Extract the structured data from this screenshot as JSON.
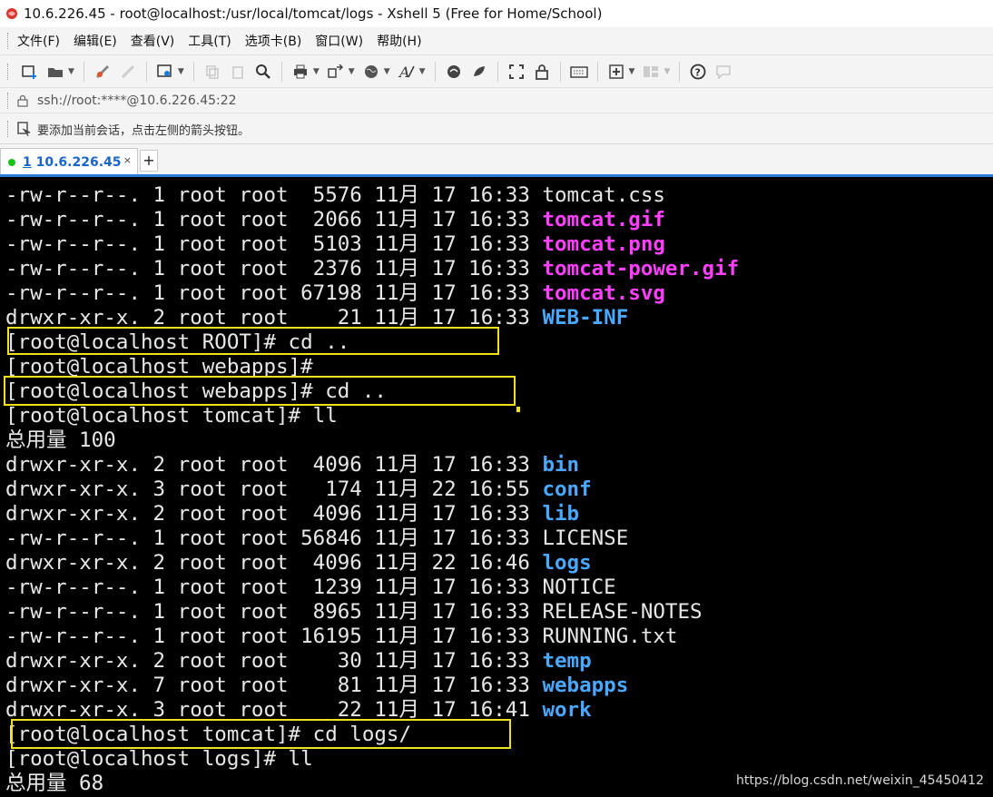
{
  "window": {
    "title": "10.6.226.45  - root@localhost:/usr/local/tomcat/logs - Xshell 5 (Free for Home/School)"
  },
  "menu": [
    {
      "label": "文件(F)"
    },
    {
      "label": "编辑(E)"
    },
    {
      "label": "查看(V)"
    },
    {
      "label": "工具(T)"
    },
    {
      "label": "选项卡(B)"
    },
    {
      "label": "窗口(W)"
    },
    {
      "label": "帮助(H)"
    }
  ],
  "address": {
    "value": "ssh://root:****@10.6.226.45:22"
  },
  "hint": {
    "text": "要添加当前会话，点击左侧的箭头按钮。"
  },
  "tab": {
    "number": "1",
    "label": "10.6.226.45",
    "close": "×",
    "add": "+"
  },
  "terminal": {
    "lines": [
      {
        "prefix": "-rw-r--r--. 1 root root  5576 11月 17 16:33 ",
        "name": "tomcat.css"
      },
      {
        "prefix": "-rw-r--r--. 1 root root  2066 11月 17 16:33 ",
        "name": "tomcat.gif"
      },
      {
        "prefix": "-rw-r--r--. 1 root root  5103 11月 17 16:33 ",
        "name": "tomcat.png"
      },
      {
        "prefix": "-rw-r--r--. 1 root root  2376 11月 17 16:33 ",
        "name": "tomcat-power.gif"
      },
      {
        "prefix": "-rw-r--r--. 1 root root 67198 11月 17 16:33 ",
        "name": "tomcat.svg"
      },
      {
        "prefix": "drwxr-xr-x. 2 root root    21 11月 17 16:33 ",
        "name": "WEB-INF"
      },
      {
        "prefix": "[root@localhost ROOT]# cd ..",
        "name": ""
      },
      {
        "prefix": "[root@localhost webapps]#",
        "name": ""
      },
      {
        "prefix": "[root@localhost webapps]# cd ..",
        "name": ""
      },
      {
        "prefix": "[root@localhost tomcat]# ll",
        "name": ""
      },
      {
        "prefix": "总用量 100",
        "name": ""
      },
      {
        "prefix": "drwxr-xr-x. 2 root root  4096 11月 17 16:33 ",
        "name": "bin"
      },
      {
        "prefix": "drwxr-xr-x. 3 root root   174 11月 22 16:55 ",
        "name": "conf"
      },
      {
        "prefix": "drwxr-xr-x. 2 root root  4096 11月 17 16:33 ",
        "name": "lib"
      },
      {
        "prefix": "-rw-r--r--. 1 root root 56846 11月 17 16:33 ",
        "name": "LICENSE"
      },
      {
        "prefix": "drwxr-xr-x. 2 root root  4096 11月 22 16:46 ",
        "name": "logs"
      },
      {
        "prefix": "-rw-r--r--. 1 root root  1239 11月 17 16:33 ",
        "name": "NOTICE"
      },
      {
        "prefix": "-rw-r--r--. 1 root root  8965 11月 17 16:33 ",
        "name": "RELEASE-NOTES"
      },
      {
        "prefix": "-rw-r--r--. 1 root root 16195 11月 17 16:33 ",
        "name": "RUNNING.txt"
      },
      {
        "prefix": "drwxr-xr-x. 2 root root    30 11月 17 16:33 ",
        "name": "temp"
      },
      {
        "prefix": "drwxr-xr-x. 7 root root    81 11月 17 16:33 ",
        "name": "webapps"
      },
      {
        "prefix": "drwxr-xr-x. 3 root root    22 11月 17 16:41 ",
        "name": "work"
      },
      {
        "prefix": "[root@localhost tomcat]# cd logs/",
        "name": ""
      },
      {
        "prefix": "[root@localhost logs]# ll",
        "name": ""
      },
      {
        "prefix": "总用量 68",
        "name": ""
      }
    ]
  },
  "watermark": {
    "text": "https://blog.csdn.net/weixin_45450412"
  },
  "colors": {
    "pink": "#ff40ff",
    "blue": "#4aa8ff",
    "highlight": "#f2e01a",
    "tab_active": "#1a66c8"
  },
  "icons": [
    "xshell-logo-icon",
    "new-session-icon",
    "open-folder-icon",
    "connect-icon",
    "disconnect-icon",
    "properties-icon",
    "copy-icon",
    "paste-icon",
    "find-icon",
    "print-icon",
    "transfer-icon",
    "globe-icon",
    "font-icon",
    "xftp-icon",
    "xmanager-icon",
    "fullscreen-icon",
    "lock-icon",
    "keyboard-icon",
    "add-icon",
    "layout-icon",
    "help-icon",
    "chat-icon"
  ]
}
